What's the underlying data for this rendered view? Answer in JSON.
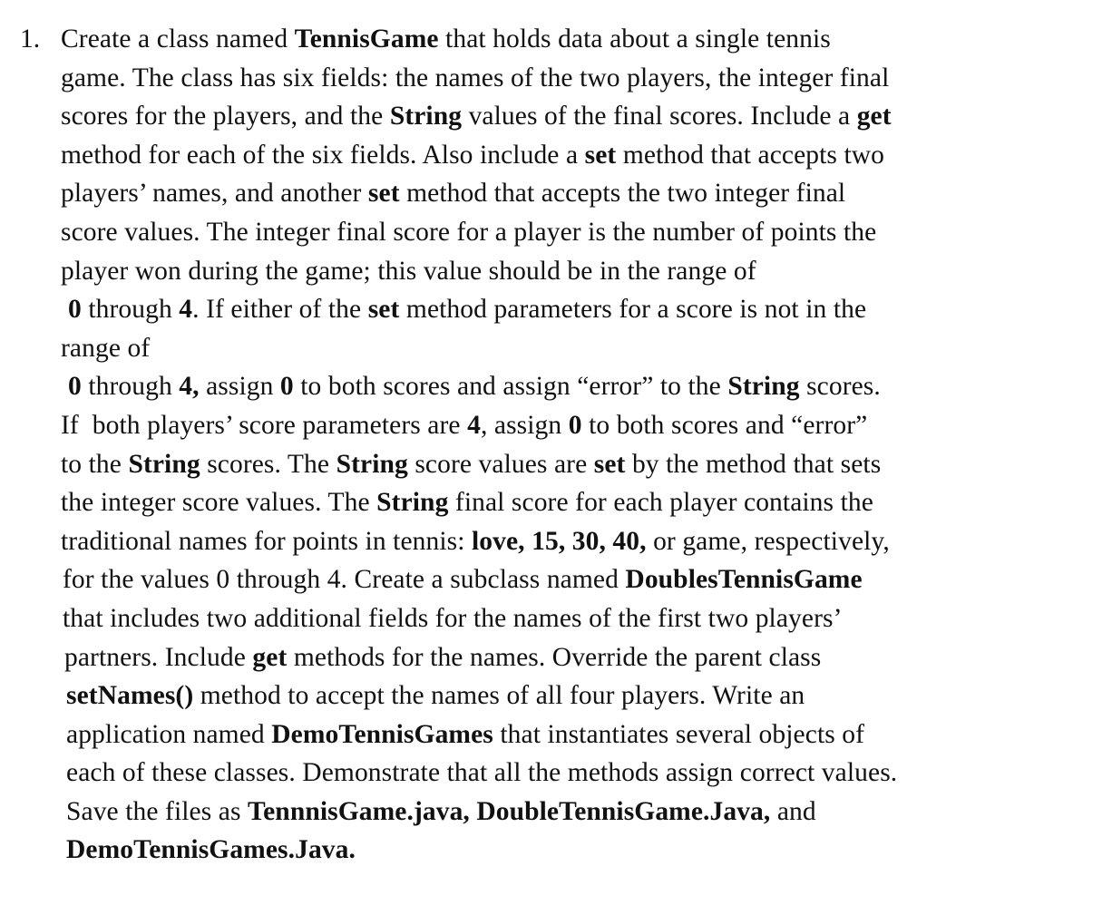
{
  "document": {
    "item_number": "1.",
    "lines": [
      {
        "indent": "",
        "segments": [
          {
            "text": "Create a class named ",
            "bold": false
          },
          {
            "text": "TennisGame",
            "bold": true
          },
          {
            "text": " that holds data about a single tennis",
            "bold": false
          }
        ]
      },
      {
        "indent": "",
        "segments": [
          {
            "text": "game. The class has six fields: the names of the two players, the integer final",
            "bold": false
          }
        ]
      },
      {
        "indent": "",
        "segments": [
          {
            "text": "scores for the players, and the ",
            "bold": false
          },
          {
            "text": "String",
            "bold": true
          },
          {
            "text": " values of the final scores. Include a ",
            "bold": false
          },
          {
            "text": "get",
            "bold": true
          }
        ]
      },
      {
        "indent": "",
        "segments": [
          {
            "text": "method for each of the six fields. Also include a ",
            "bold": false
          },
          {
            "text": "set",
            "bold": true
          },
          {
            "text": " method that accepts two",
            "bold": false
          }
        ]
      },
      {
        "indent": "",
        "segments": [
          {
            "text": "players’ names, and another ",
            "bold": false
          },
          {
            "text": "set",
            "bold": true
          },
          {
            "text": " method that accepts the two integer final",
            "bold": false
          }
        ]
      },
      {
        "indent": "",
        "segments": [
          {
            "text": "score values. The integer final score for a player is the number of points the",
            "bold": false
          }
        ]
      },
      {
        "indent": "",
        "segments": [
          {
            "text": "player won during the game; this value should be in the range of",
            "bold": false
          }
        ]
      },
      {
        "indent": "indent",
        "segments": [
          {
            "text": "0",
            "bold": true
          },
          {
            "text": " through ",
            "bold": false
          },
          {
            "text": "4",
            "bold": true
          },
          {
            "text": ". If either of the ",
            "bold": false
          },
          {
            "text": "set",
            "bold": true
          },
          {
            "text": " method parameters for a score is not in the",
            "bold": false
          }
        ]
      },
      {
        "indent": "",
        "segments": [
          {
            "text": "range of",
            "bold": false
          }
        ]
      },
      {
        "indent": "indent",
        "segments": [
          {
            "text": "0",
            "bold": true
          },
          {
            "text": " through ",
            "bold": false
          },
          {
            "text": "4,",
            "bold": true
          },
          {
            "text": " assign ",
            "bold": false
          },
          {
            "text": "0",
            "bold": true
          },
          {
            "text": " to both scores and assign “error” to the ",
            "bold": false
          },
          {
            "text": "String",
            "bold": true
          },
          {
            "text": " scores.",
            "bold": false
          }
        ]
      },
      {
        "indent": "",
        "segments": [
          {
            "text": "If  both players’ score parameters are ",
            "bold": false
          },
          {
            "text": "4",
            "bold": true
          },
          {
            "text": ", assign ",
            "bold": false
          },
          {
            "text": "0",
            "bold": true
          },
          {
            "text": " to both scores and “error”",
            "bold": false
          }
        ]
      },
      {
        "indent": "",
        "segments": [
          {
            "text": "to the ",
            "bold": false
          },
          {
            "text": "String",
            "bold": true
          },
          {
            "text": " scores. The ",
            "bold": false
          },
          {
            "text": "String",
            "bold": true
          },
          {
            "text": " score values are ",
            "bold": false
          },
          {
            "text": "set",
            "bold": true
          },
          {
            "text": " by the method that sets",
            "bold": false
          }
        ]
      },
      {
        "indent": "",
        "segments": [
          {
            "text": "the integer score values. The ",
            "bold": false
          },
          {
            "text": "String",
            "bold": true
          },
          {
            "text": " final score for each player contains the",
            "bold": false
          }
        ]
      },
      {
        "indent": "",
        "segments": [
          {
            "text": "traditional names for points in tennis: ",
            "bold": false
          },
          {
            "text": "love, 15, 30, 40,",
            "bold": true
          },
          {
            "text": " or game, respectively,",
            "bold": false
          }
        ]
      },
      {
        "indent": "indent2",
        "segments": [
          {
            "text": "for the values 0 through 4. Create a subclass named ",
            "bold": false
          },
          {
            "text": "DoublesTennisGame",
            "bold": true
          }
        ]
      },
      {
        "indent": "indent2",
        "segments": [
          {
            "text": "that includes two additional fields for the names of the first two players’",
            "bold": false
          }
        ]
      },
      {
        "indent": "indent3",
        "segments": [
          {
            "text": "partners. Include ",
            "bold": false
          },
          {
            "text": "get",
            "bold": true
          },
          {
            "text": " methods for the names. Override the parent class",
            "bold": false
          }
        ]
      },
      {
        "indent": "indent4",
        "segments": [
          {
            "text": "setNames()",
            "bold": true
          },
          {
            "text": " method to accept the names of all four players. Write an",
            "bold": false
          }
        ]
      },
      {
        "indent": "indent4",
        "segments": [
          {
            "text": "application named ",
            "bold": false
          },
          {
            "text": "DemoTennisGames",
            "bold": true
          },
          {
            "text": " that instantiates several objects of",
            "bold": false
          }
        ]
      },
      {
        "indent": "indent4",
        "segments": [
          {
            "text": "each of these classes. Demonstrate that all the methods assign correct values.",
            "bold": false
          }
        ]
      },
      {
        "indent": "indent4",
        "segments": [
          {
            "text": "Save the files as ",
            "bold": false
          },
          {
            "text": "TennnisGame.java, DoubleTennisGame.Java,",
            "bold": true
          },
          {
            "text": " and",
            "bold": false
          }
        ]
      },
      {
        "indent": "indent4",
        "segments": [
          {
            "text": "DemoTennisGames.Java.",
            "bold": true
          }
        ]
      }
    ]
  }
}
